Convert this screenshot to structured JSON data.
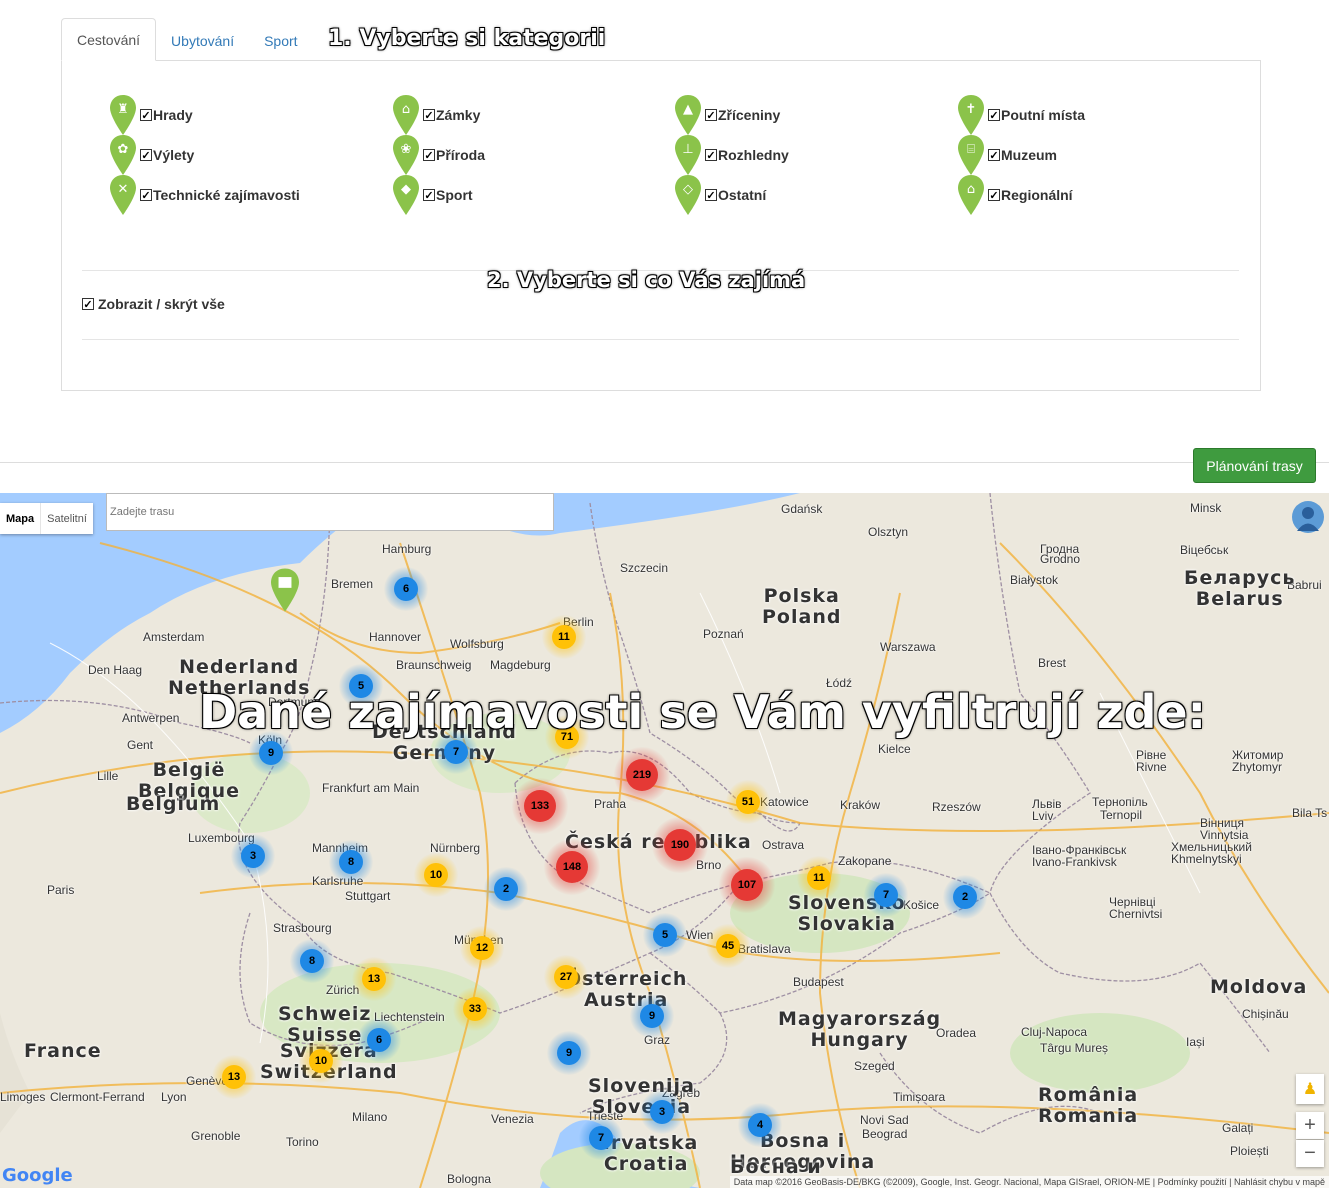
{
  "tabs": [
    {
      "label": "Cestování",
      "active": true
    },
    {
      "label": "Ubytování",
      "active": false
    },
    {
      "label": "Sport",
      "active": false
    }
  ],
  "step1": "1. Vyberte si kategorii",
  "step2": "2. Vyberte si co Vás zajímá",
  "categories": [
    {
      "label": "Hrady",
      "icon": "castle-icon",
      "checked": true
    },
    {
      "label": "Zámky",
      "icon": "chateau-icon",
      "checked": true
    },
    {
      "label": "Zříceniny",
      "icon": "ruin-icon",
      "checked": true
    },
    {
      "label": "Poutní místa",
      "icon": "pilgrimage-icon",
      "checked": true
    },
    {
      "label": "Výlety",
      "icon": "trip-icon",
      "checked": true
    },
    {
      "label": "Příroda",
      "icon": "nature-icon",
      "checked": true
    },
    {
      "label": "Rozhledny",
      "icon": "lookout-tower-icon",
      "checked": true
    },
    {
      "label": "Muzeum",
      "icon": "museum-icon",
      "checked": true
    },
    {
      "label": "Technické zajímavosti",
      "icon": "tools-icon",
      "checked": true
    },
    {
      "label": "Sport",
      "icon": "sport-icon",
      "checked": true
    },
    {
      "label": "Ostatní",
      "icon": "other-icon",
      "checked": true
    },
    {
      "label": "Regionální",
      "icon": "regional-icon",
      "checked": true
    }
  ],
  "toggle_all": "Zobrazit / skrýt vše",
  "plan_button": "Plánování trasy",
  "map": {
    "type_map": "Mapa",
    "type_satellite": "Satelitní",
    "route_placeholder": "Zadejte trasu",
    "caption": "Dané zajímavosti se Vám vyfiltrují zde:",
    "copyright": "Data map ©2016 GeoBasis-DE/BKG (©2009), Google, Inst. Geogr. Nacional, Mapa GISrael, ORION-ME  |  Podmínky použití  |  Nahlásit chybu v mapě",
    "google": "Google",
    "zoom_in": "+",
    "zoom_out": "−",
    "cities": [
      "Gdańsk",
      "Olsztyn",
      "Minsk",
      "Hamburg",
      "Szczecin",
      "Bremen",
      "Berlin",
      "Poznań",
      "Amsterdam",
      "Hannover",
      "Wolfsburg",
      "Warszawa",
      "Den Haag",
      "Braunschweig",
      "Magdeburg",
      "Brest",
      "Łódź",
      "Antwerpen",
      "Dortmund",
      "Gent",
      "Köln",
      "Lille",
      "Kielce",
      "Frankfurt am Main",
      "Praha",
      "Katowice",
      "Kraków",
      "Rzeszów",
      "Luxembourg",
      "Mannheim",
      "Nürnberg",
      "Ostrava",
      "Karlsruhe",
      "Brno",
      "Zakopane",
      "Paris",
      "Stuttgart",
      "Košice",
      "Strasbourg",
      "München",
      "Wien",
      "Bratislava",
      "Zürich",
      "Liechtenstein",
      "Graz",
      "Budapest",
      "Genève",
      "Lyon",
      "Milano",
      "Venezia",
      "Trieste",
      "Zagreb",
      "Torino",
      "Grenoble",
      "Bologna",
      "Timișoara",
      "Cluj-Napoca",
      "Oradea",
      "Szeged",
      "Novi Sad",
      "Beograd",
      "Iași",
      "Chișinău",
      "Galați",
      "Ploiești",
      "Тернопіль",
      "Ternopil",
      "Вінниця",
      "Vinnytsia",
      "Житомир",
      "Zhytomyr",
      "Рівне",
      "Rivne",
      "Львів",
      "Lviv",
      "Чернівці",
      "Chernivtsi",
      "Івано-Франківськ",
      "Ivano-Frankivsk",
      "Хмельницький",
      "Khmelnytskyi",
      "Clermont-Ferrand",
      "Limoges",
      "Târgu Mureș",
      "Bila Ts",
      "Babrui",
      "Гродна",
      "Grodno",
      "Białystok",
      "Віцебськ"
    ],
    "countries": [
      {
        "name": "Polska",
        "sub": "Poland"
      },
      {
        "name": "Nederland",
        "sub": "Netherlands"
      },
      {
        "name": "Deutschland",
        "sub": "Germany"
      },
      {
        "name": "België",
        "sub": "Belgique"
      },
      {
        "name": "Belgium",
        "sub": ""
      },
      {
        "name": "Česká republika",
        "sub": ""
      },
      {
        "name": "Slovensko",
        "sub": "Slovakia"
      },
      {
        "name": "Österreich",
        "sub": "Austria"
      },
      {
        "name": "Schweiz",
        "sub": "Suisse"
      },
      {
        "name": "Svizzera",
        "sub": "Switzerland"
      },
      {
        "name": "France",
        "sub": ""
      },
      {
        "name": "Magyarország",
        "sub": "Hungary"
      },
      {
        "name": "Slovenija",
        "sub": "Slovenia"
      },
      {
        "name": "Hrvatska",
        "sub": "Croatia"
      },
      {
        "name": "Bosna i",
        "sub": "Hercegovina"
      },
      {
        "name": "Босна и",
        "sub": ""
      },
      {
        "name": "România",
        "sub": "Romania"
      },
      {
        "name": "Moldova",
        "sub": ""
      },
      {
        "name": "Беларусь",
        "sub": "Belarus"
      }
    ],
    "clusters": [
      {
        "count": "6",
        "color": "blue"
      },
      {
        "count": "11",
        "color": "yellow"
      },
      {
        "count": "5",
        "color": "blue"
      },
      {
        "count": "71",
        "color": "yellow"
      },
      {
        "count": "9",
        "color": "blue"
      },
      {
        "count": "7",
        "color": "blue"
      },
      {
        "count": "219",
        "color": "red"
      },
      {
        "count": "133",
        "color": "red"
      },
      {
        "count": "51",
        "color": "yellow"
      },
      {
        "count": "190",
        "color": "red"
      },
      {
        "count": "3",
        "color": "blue"
      },
      {
        "count": "8",
        "color": "blue"
      },
      {
        "count": "148",
        "color": "red"
      },
      {
        "count": "10",
        "color": "yellow"
      },
      {
        "count": "2",
        "color": "blue"
      },
      {
        "count": "107",
        "color": "red"
      },
      {
        "count": "11",
        "color": "yellow"
      },
      {
        "count": "7",
        "color": "blue"
      },
      {
        "count": "2",
        "color": "blue"
      },
      {
        "count": "5",
        "color": "blue"
      },
      {
        "count": "45",
        "color": "yellow"
      },
      {
        "count": "12",
        "color": "yellow"
      },
      {
        "count": "8",
        "color": "blue"
      },
      {
        "count": "13",
        "color": "yellow"
      },
      {
        "count": "27",
        "color": "yellow"
      },
      {
        "count": "33",
        "color": "yellow"
      },
      {
        "count": "9",
        "color": "blue"
      },
      {
        "count": "6",
        "color": "blue"
      },
      {
        "count": "10",
        "color": "yellow"
      },
      {
        "count": "9",
        "color": "blue"
      },
      {
        "count": "13",
        "color": "yellow"
      },
      {
        "count": "3",
        "color": "blue"
      },
      {
        "count": "7",
        "color": "blue"
      },
      {
        "count": "4",
        "color": "blue"
      }
    ]
  },
  "colors": {
    "blue": "#1e88e5",
    "yellow": "#ffc107",
    "red": "#e53935",
    "pin": "#8bc34a",
    "button": "#3f9b3f"
  }
}
